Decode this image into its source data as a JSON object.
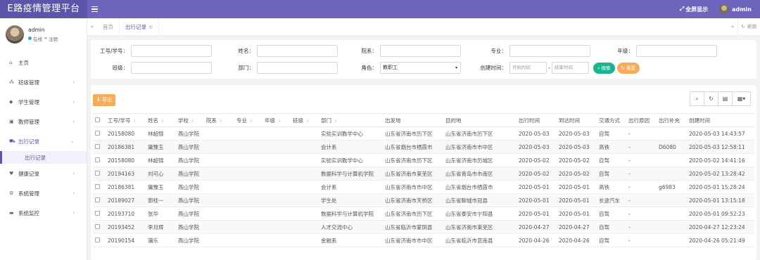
{
  "brand": "E路疫情管理平台",
  "topbar": {
    "fullscreen_label": "全屏显示",
    "username": "admin"
  },
  "profile": {
    "name": "admin",
    "online": "在线",
    "logout": "注销"
  },
  "sidebar": {
    "items": [
      {
        "label": "主页",
        "icon": "home-icon"
      },
      {
        "label": "班级管理",
        "icon": "class-icon"
      },
      {
        "label": "学生管理",
        "icon": "student-icon"
      },
      {
        "label": "教师管理",
        "icon": "teacher-icon"
      },
      {
        "label": "出行记录",
        "icon": "car-icon"
      },
      {
        "label": "健康记录",
        "icon": "heart-icon"
      },
      {
        "label": "系统管理",
        "icon": "gear-icon"
      },
      {
        "label": "系统监控",
        "icon": "monitor-icon"
      }
    ],
    "submenu_active": "出行记录"
  },
  "tabs": [
    {
      "label": "首页"
    },
    {
      "label": "出行记录"
    }
  ],
  "refresh_label": "刷新",
  "search": {
    "id_label": "工号/学号：",
    "name_label": "姓名：",
    "dept_label": "院系：",
    "major_label": "专业：",
    "grade_label": "年级：",
    "class_label": "班级：",
    "department_label": "部门：",
    "role_label": "角色：",
    "role_value": "教职工",
    "time_label": "创建时间：",
    "start_placeholder": "开始时间",
    "end_placeholder": "结束时间",
    "search_btn": "搜索",
    "reset_btn": "重置"
  },
  "table": {
    "export_label": "导出",
    "columns": [
      "工号/学号",
      "姓名",
      "学校",
      "院系",
      "专业",
      "年级",
      "班级",
      "部门",
      "出发地",
      "目的地",
      "出行时间",
      "到达时间",
      "交通方式",
      "出行原因",
      "出行补充",
      "创建时间"
    ],
    "rows": [
      [
        "20158080",
        "林超锦",
        "燕山学院",
        "",
        "",
        "",
        "",
        "实验实训教学中心",
        "山东省济南市历下区",
        "山东省济南市历下区",
        "2020-05-03",
        "2020-05-03",
        "自驾",
        "-",
        "",
        "2020-05-03 14:43:57"
      ],
      [
        "20186381",
        "庸豫玉",
        "燕山学院",
        "",
        "",
        "",
        "",
        "会计系",
        "山东省烟台市栖霞市",
        "山东省济南市市中区",
        "2020-05-03",
        "2020-05-03",
        "高铁",
        "-",
        "D6080",
        "2020-05-03 12:58:11"
      ],
      [
        "20158080",
        "林超锦",
        "燕山学院",
        "",
        "",
        "",
        "",
        "实验实训教学中心",
        "山东省济南市历下区",
        "山东省济南市历城区",
        "2020-05-02",
        "2020-05-02",
        "自驾",
        "-",
        "",
        "2020-05-02 14:41:16"
      ],
      [
        "20194163",
        "刘可心",
        "燕山学院",
        "",
        "",
        "",
        "",
        "数据科学与计算机学院",
        "山东省济南市莱芜区",
        "山东省青岛市市南区",
        "2020-05-02",
        "2020-05-02",
        "自驾",
        "-",
        "",
        "2020-05-02 13:28:42"
      ],
      [
        "20186381",
        "庸豫玉",
        "燕山学院",
        "",
        "",
        "",
        "",
        "会计系",
        "山东省济南市市中区",
        "山东省烟台市栖霞市",
        "2020-05-01",
        "2020-05-01",
        "高铁",
        "-",
        "g6983",
        "2020-05-01 15:28:24"
      ],
      [
        "20189027",
        "郭桂一",
        "燕山学院",
        "",
        "",
        "",
        "",
        "学生处",
        "山东省济南市天桥区",
        "山东省聊城市冠县",
        "2020-05-01",
        "2020-05-01",
        "长途汽车",
        "-",
        "",
        "2020-05-01 13:15:18"
      ],
      [
        "20193710",
        "张华",
        "燕山学院",
        "",
        "",
        "",
        "",
        "数据科学与计算机学院",
        "山东省济南市历下区",
        "山东省泰安市宁阳县",
        "2020-05-01",
        "2020-05-01",
        "自驾",
        "-",
        "",
        "2020-05-01 09:52:23"
      ],
      [
        "20193452",
        "李月辉",
        "燕山学院",
        "",
        "",
        "",
        "",
        "人才交流中心",
        "山东省临沂市蒙阴县",
        "山东省济南市莱芜区",
        "2020-04-27",
        "2020-04-27",
        "自驾",
        "-",
        "",
        "2020-04-27 12:23:24"
      ],
      [
        "20190154",
        "蒲乐",
        "燕山学院",
        "",
        "",
        "",
        "",
        "金融系",
        "山东省济南市市中区",
        "山东省临沂市莒南县",
        "2020-04-26",
        "2020-04-26",
        "自驾",
        "-",
        "",
        "2020-04-26 05:21:49"
      ]
    ]
  }
}
